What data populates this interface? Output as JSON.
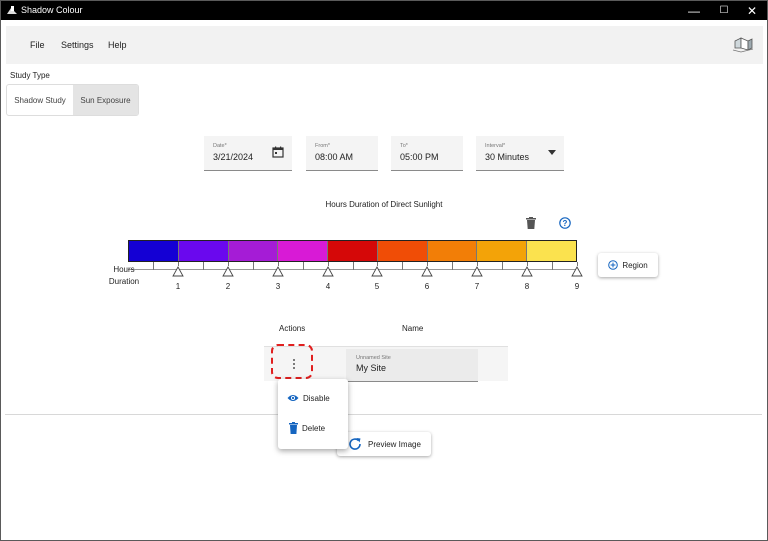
{
  "window": {
    "title": "Shadow Colour",
    "minimize": "—",
    "maximize": "☐",
    "close": "✕"
  },
  "menu": {
    "file": "File",
    "settings": "Settings",
    "help": "Help"
  },
  "study_type": {
    "label": "Study Type",
    "options": [
      "Shadow Study",
      "Sun Exposure"
    ],
    "selected": "Sun Exposure"
  },
  "fields": {
    "date": {
      "label": "Date*",
      "value": "3/21/2024"
    },
    "from": {
      "label": "From*",
      "value": "08:00 AM"
    },
    "to": {
      "label": "To*",
      "value": "05:00 PM"
    },
    "interval": {
      "label": "Interval*",
      "value": "30 Minutes"
    }
  },
  "scale": {
    "title": "Hours Duration of Direct Sunlight",
    "axis_title_1": "Hours",
    "axis_title_2": "Duration",
    "colors": [
      "#1400d4",
      "#6a08ee",
      "#a51cd6",
      "#d81ad6",
      "#d50808",
      "#f04d06",
      "#f27e07",
      "#f3a308",
      "#fbe24e"
    ],
    "tick_labels": [
      "1",
      "2",
      "3",
      "4",
      "5",
      "6",
      "7",
      "8",
      "9"
    ]
  },
  "region_button": "Region",
  "table": {
    "columns": [
      "Actions",
      "Name"
    ],
    "rows": [
      {
        "name_label": "Unnamed Site",
        "name": "My Site"
      }
    ]
  },
  "context_menu": {
    "items": [
      "Disable",
      "Delete"
    ]
  },
  "preview_button": "Preview Image",
  "accent": "#1565c0"
}
